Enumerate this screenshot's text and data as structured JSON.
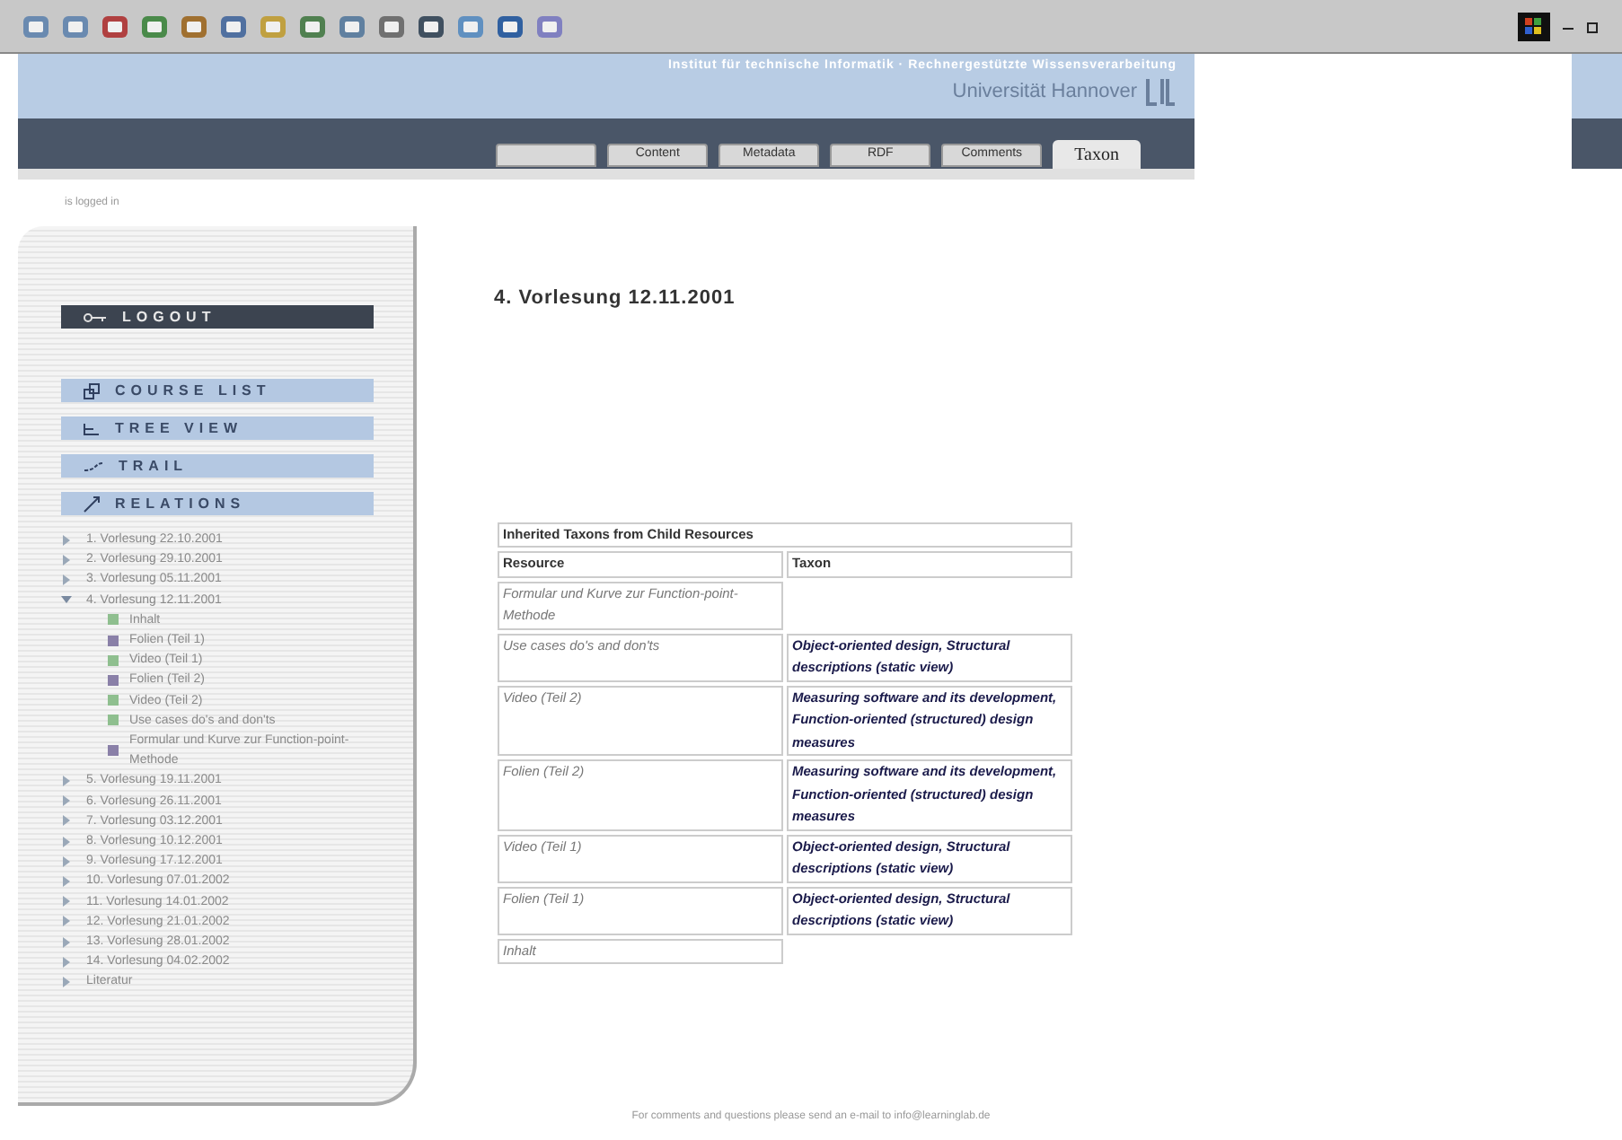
{
  "header": {
    "institute": "Institut für technische Informatik · Rechnergestützte Wissensverarbeitung",
    "university": "Universität Hannover"
  },
  "tabs": [
    {
      "selected": false
    },
    {
      "label": "Content",
      "selected": false
    },
    {
      "label": "Metadata",
      "selected": false
    },
    {
      "label": "RDF",
      "selected": false
    },
    {
      "label": "Comments",
      "selected": false
    },
    {
      "label": "Taxon",
      "selected": true
    }
  ],
  "login_status": "is logged in",
  "menu": [
    {
      "label": "LOGOUT",
      "kind": "logout"
    },
    {
      "label": "COURSE LIST",
      "kind": "courses"
    },
    {
      "label": "TREE VIEW",
      "kind": "tree"
    },
    {
      "label": "TRAIL",
      "kind": "trail"
    },
    {
      "label": "RELATIONS",
      "kind": "relations"
    }
  ],
  "tree": [
    {
      "label": "1. Vorlesung 22.10.2001",
      "expanded": false
    },
    {
      "label": "2. Vorlesung 29.10.2001",
      "expanded": false
    },
    {
      "label": "3. Vorlesung 05.11.2001",
      "expanded": false
    },
    {
      "label": "4. Vorlesung 12.11.2001",
      "expanded": true,
      "children": [
        {
          "label": "Inhalt",
          "color": "#8fbf8f"
        },
        {
          "label": "Folien (Teil 1)",
          "color": "#8a80a8"
        },
        {
          "label": "Video (Teil 1)",
          "color": "#8fbf8f"
        },
        {
          "label": "Folien (Teil 2)",
          "color": "#8a80a8"
        },
        {
          "label": "Video (Teil 2)",
          "color": "#8fbf8f"
        },
        {
          "label": "Use cases do's and don'ts",
          "color": "#8fbf8f"
        },
        {
          "label": "Formular und Kurve zur Function-point-Methode",
          "color": "#8a80a8"
        }
      ]
    },
    {
      "label": "5. Vorlesung 19.11.2001",
      "expanded": false
    },
    {
      "label": "6. Vorlesung 26.11.2001",
      "expanded": false
    },
    {
      "label": "7. Vorlesung 03.12.2001",
      "expanded": false
    },
    {
      "label": "8. Vorlesung 10.12.2001",
      "expanded": false
    },
    {
      "label": "9. Vorlesung 17.12.2001",
      "expanded": false
    },
    {
      "label": "10. Vorlesung 07.01.2002",
      "expanded": false
    },
    {
      "label": "11. Vorlesung 14.01.2002",
      "expanded": false
    },
    {
      "label": "12. Vorlesung 21.01.2002",
      "expanded": false
    },
    {
      "label": "13. Vorlesung 28.01.2002",
      "expanded": false
    },
    {
      "label": "14. Vorlesung 04.02.2002",
      "expanded": false
    },
    {
      "label": "Literatur",
      "expanded": false
    }
  ],
  "page_title": "4. Vorlesung 12.11.2001",
  "table": {
    "title": "Inherited Taxons from Child Resources",
    "columns": [
      "Resource",
      "Taxon"
    ],
    "rows": [
      {
        "resource": "Formular und Kurve zur Function-point-Methode"
      },
      {
        "resource": "Use cases do's and don'ts",
        "taxon": "Object-oriented design, Structural descriptions (static view)"
      },
      {
        "resource": "Video (Teil 2)",
        "taxon": "Measuring software and its development, Function-oriented (structured) design measures"
      },
      {
        "resource": "Folien (Teil 2)",
        "taxon": "Measuring software and its development, Function-oriented (structured) design measures"
      },
      {
        "resource": "Video (Teil 1)",
        "taxon": "Object-oriented design, Structural descriptions (static view)"
      },
      {
        "resource": "Folien (Teil 1)",
        "taxon": "Object-oriented design, Structural descriptions (static view)"
      },
      {
        "resource": "Inhalt"
      }
    ]
  },
  "footer": "For comments and questions please send an e-mail to info@learninglab.de"
}
